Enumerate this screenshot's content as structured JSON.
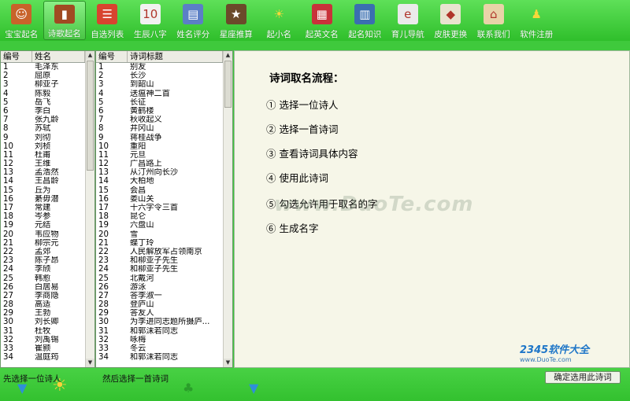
{
  "toolbar": {
    "items": [
      {
        "label": "宝宝起名",
        "icon": "baby-portrait-icon",
        "glyph": "☺",
        "bg": "#c8632a"
      },
      {
        "label": "诗歌起名",
        "icon": "book-icon",
        "glyph": "▮",
        "bg": "#a14a22",
        "active": true
      },
      {
        "label": "自选列表",
        "icon": "list-icon",
        "glyph": "☰",
        "bg": "#d8442f"
      },
      {
        "label": "生辰八字",
        "icon": "calendar-icon",
        "glyph": "10",
        "bg": "#f1f1f1"
      },
      {
        "label": "姓名评分",
        "icon": "score-chart-icon",
        "glyph": "▤",
        "bg": "#5b7fc6"
      },
      {
        "label": "星座推算",
        "icon": "star-icon",
        "glyph": "★",
        "bg": "#6b4a2a"
      },
      {
        "label": "起小名",
        "icon": "sun-icon",
        "glyph": "☀",
        "bg": "transparent"
      },
      {
        "label": "起英文名",
        "icon": "us-flag-icon",
        "glyph": "▦",
        "bg": "#c8323a"
      },
      {
        "label": "起名知识",
        "icon": "books-icon",
        "glyph": "▥",
        "bg": "#3a6fb0"
      },
      {
        "label": "育儿导航",
        "icon": "footprint-icon",
        "glyph": "e",
        "bg": "#eaeaea"
      },
      {
        "label": "皮肤更换",
        "icon": "palette-icon",
        "glyph": "◆",
        "bg": "#e9e3cf"
      },
      {
        "label": "联系我们",
        "icon": "house-icon",
        "glyph": "⌂",
        "bg": "#e8d3a8"
      },
      {
        "label": "软件注册",
        "icon": "users-icon",
        "glyph": "♟",
        "bg": "transparent"
      }
    ]
  },
  "poets": {
    "headers": [
      "编号",
      "姓名"
    ],
    "rows": [
      [
        "1",
        "毛泽东"
      ],
      [
        "2",
        "屈原"
      ],
      [
        "3",
        "柳亚子"
      ],
      [
        "4",
        "陈毅"
      ],
      [
        "5",
        "岳飞"
      ],
      [
        "6",
        "李白"
      ],
      [
        "7",
        "张九龄"
      ],
      [
        "8",
        "苏轼"
      ],
      [
        "9",
        "刘彻"
      ],
      [
        "10",
        "刘桢"
      ],
      [
        "11",
        "杜甫"
      ],
      [
        "12",
        "王维"
      ],
      [
        "13",
        "孟浩然"
      ],
      [
        "14",
        "王昌龄"
      ],
      [
        "15",
        "丘为"
      ],
      [
        "16",
        "綦毋潜"
      ],
      [
        "17",
        "常建"
      ],
      [
        "18",
        "岑参"
      ],
      [
        "19",
        "元结"
      ],
      [
        "20",
        "韦应物"
      ],
      [
        "21",
        "柳宗元"
      ],
      [
        "22",
        "孟郊"
      ],
      [
        "23",
        "陈子昂"
      ],
      [
        "24",
        "李颀"
      ],
      [
        "25",
        "韩愈"
      ],
      [
        "26",
        "白居易"
      ],
      [
        "27",
        "李商隐"
      ],
      [
        "28",
        "高适"
      ],
      [
        "29",
        "王勃"
      ],
      [
        "30",
        "刘长卿"
      ],
      [
        "31",
        "杜牧"
      ],
      [
        "32",
        "刘禹锡"
      ],
      [
        "33",
        "崔颢"
      ],
      [
        "34",
        "温庭筠"
      ]
    ]
  },
  "poems": {
    "headers": [
      "编号",
      "诗词标题"
    ],
    "rows": [
      [
        "1",
        "别友"
      ],
      [
        "2",
        "长沙"
      ],
      [
        "3",
        "到韶山"
      ],
      [
        "4",
        "送瘟神二首"
      ],
      [
        "5",
        "长征"
      ],
      [
        "6",
        "黄鹤楼"
      ],
      [
        "7",
        "秋收起义"
      ],
      [
        "8",
        "井冈山"
      ],
      [
        "9",
        "蒋桂战争"
      ],
      [
        "10",
        "重阳"
      ],
      [
        "11",
        "元旦"
      ],
      [
        "12",
        "广昌路上"
      ],
      [
        "13",
        "从汀州向长沙"
      ],
      [
        "14",
        "大柏地"
      ],
      [
        "15",
        "会昌"
      ],
      [
        "16",
        "娄山关"
      ],
      [
        "17",
        "十六字令三首"
      ],
      [
        "18",
        "昆仑"
      ],
      [
        "19",
        "六盘山"
      ],
      [
        "20",
        "雪"
      ],
      [
        "21",
        "蝶丁玲"
      ],
      [
        "22",
        "人民解放军占领南京"
      ],
      [
        "23",
        "和柳亚子先生"
      ],
      [
        "24",
        "和柳亚子先生"
      ],
      [
        "25",
        "北戴河"
      ],
      [
        "26",
        "游泳"
      ],
      [
        "27",
        "答李淑一"
      ],
      [
        "28",
        "登庐山"
      ],
      [
        "29",
        "答友人"
      ],
      [
        "30",
        "为李进同志题所摄庐..."
      ],
      [
        "31",
        "和郭沫若同志"
      ],
      [
        "32",
        "咏梅"
      ],
      [
        "33",
        "冬云"
      ],
      [
        "34",
        "和郭沫若同志"
      ]
    ]
  },
  "info": {
    "title": "诗词取名流程：",
    "steps": [
      "① 选择一位诗人",
      "② 选择一首诗词",
      "③ 查看诗词具体内容",
      "④ 使用此诗词",
      "⑤ 勾选允许用于取名的字",
      "⑥ 生成名字"
    ],
    "watermark": "www.DuoTe.com"
  },
  "bottom": {
    "hint_poet": "先选择一位诗人",
    "hint_poem": "然后选择一首诗词",
    "confirm_label": "确定选用此诗词"
  },
  "brand": {
    "logo": "2345软件大全",
    "url": "www.DuoTe.com"
  }
}
